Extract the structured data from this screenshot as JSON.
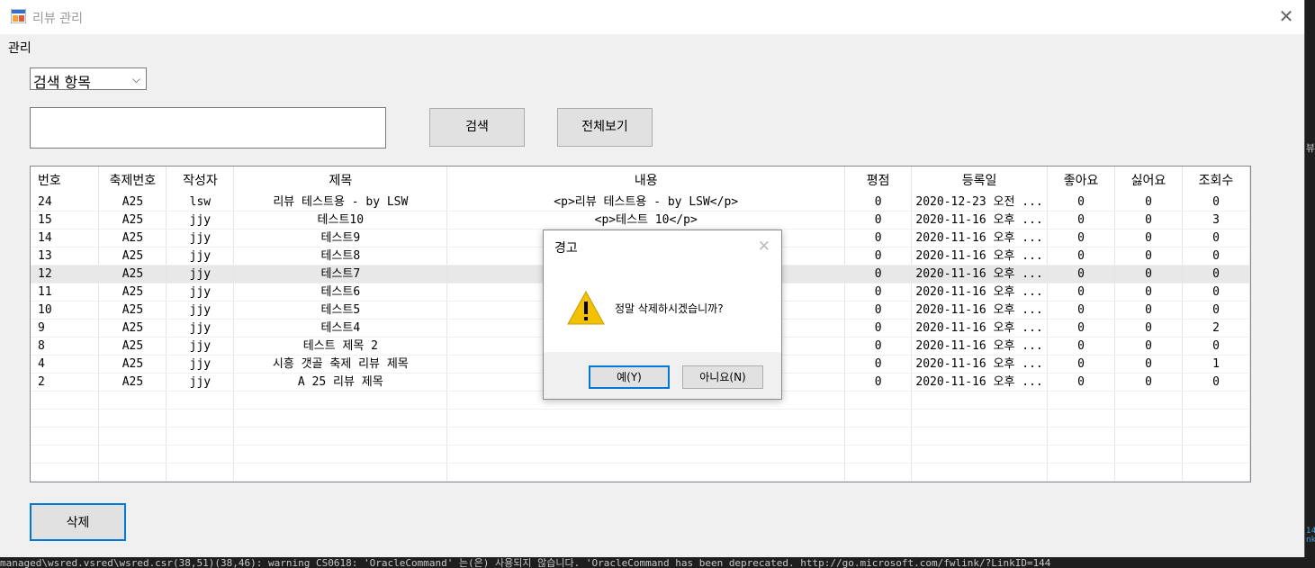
{
  "window": {
    "title": "리뷰 관리",
    "close_glyph": "✕"
  },
  "menu": {
    "item": "관리"
  },
  "search": {
    "combo_value": "검색 항목",
    "combo_arrow": "⌵",
    "input_value": "",
    "search_label": "검색",
    "view_all_label": "전체보기"
  },
  "grid": {
    "columns": [
      "번호",
      "축제번호",
      "작성자",
      "제목",
      "내용",
      "평점",
      "등록일",
      "좋아요",
      "싫어요",
      "조회수"
    ],
    "rows": [
      [
        "24",
        "A25",
        "lsw",
        "리뷰 테스트용 - by LSW",
        "<p>리뷰 테스트용 - by LSW</p>",
        "0",
        "2020-12-23 오전 ...",
        "0",
        "0",
        "0"
      ],
      [
        "15",
        "A25",
        "jjy",
        "테스트10",
        "<p>테스트 10</p>",
        "0",
        "2020-11-16 오후 ...",
        "0",
        "0",
        "3"
      ],
      [
        "14",
        "A25",
        "jjy",
        "테스트9",
        "",
        "0",
        "2020-11-16 오후 ...",
        "0",
        "0",
        "0"
      ],
      [
        "13",
        "A25",
        "jjy",
        "테스트8",
        "",
        "0",
        "2020-11-16 오후 ...",
        "0",
        "0",
        "0"
      ],
      [
        "12",
        "A25",
        "jjy",
        "테스트7",
        "",
        "0",
        "2020-11-16 오후 ...",
        "0",
        "0",
        "0"
      ],
      [
        "11",
        "A25",
        "jjy",
        "테스트6",
        "",
        "0",
        "2020-11-16 오후 ...",
        "0",
        "0",
        "0"
      ],
      [
        "10",
        "A25",
        "jjy",
        "테스트5",
        "",
        "0",
        "2020-11-16 오후 ...",
        "0",
        "0",
        "0"
      ],
      [
        "9",
        "A25",
        "jjy",
        "테스트4",
        "",
        "0",
        "2020-11-16 오후 ...",
        "0",
        "0",
        "2"
      ],
      [
        "8",
        "A25",
        "jjy",
        "테스트 제목 2",
        "",
        "0",
        "2020-11-16 오후 ...",
        "0",
        "0",
        "0"
      ],
      [
        "4",
        "A25",
        "jjy",
        "시흥 갯골 축제 리뷰 제목",
        "",
        "0",
        "2020-11-16 오후 ...",
        "0",
        "0",
        "1"
      ],
      [
        "2",
        "A25",
        "jjy",
        "A 25 리뷰 제목",
        "",
        "0",
        "2020-11-16 오후 ...",
        "0",
        "0",
        "0"
      ]
    ],
    "selected_row": 4,
    "empty_rows": 5
  },
  "delete_label": "삭제",
  "dialog": {
    "title": "경고",
    "close_glyph": "✕",
    "message": "정말 삭제하시겠습니까?",
    "yes_label": "예(Y)",
    "no_label": "아니요(N)"
  },
  "background": {
    "console_text": "managed\\wsred.vsred\\wsred.csr(38,51)(38,46): warning CS0618: 'OracleCommand' 는(은) 사용되지 않습니다. 'OracleCommand has been deprecated. http://go.microsoft.com/fwlink/?LinkID=144",
    "right_glyph": "뷰",
    "right_mark": "14 nk"
  },
  "colors": {
    "accent": "#0078d7",
    "window_bg": "#f0f0f0",
    "warning": "#f2c200"
  }
}
